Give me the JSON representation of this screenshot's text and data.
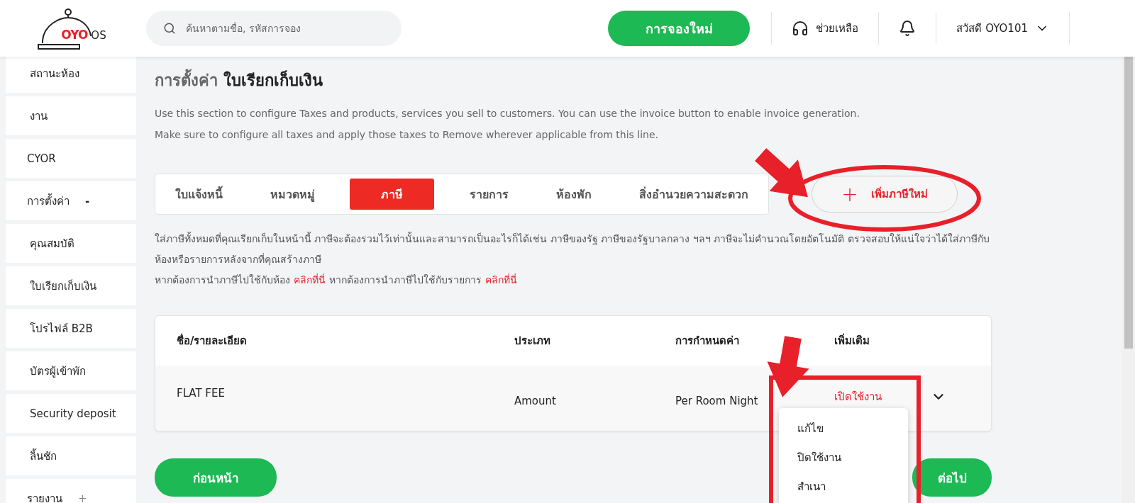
{
  "header": {
    "logo": {
      "brand": "OYO",
      "product": "OS"
    },
    "search": {
      "placeholder": "ค้นหาตามชื่อ, รหัสการจอง"
    },
    "new_booking_button": "การจองใหม่",
    "help": "ช่วยเหลือ",
    "user_menu": "สวัสดี OYO101"
  },
  "sidebar": {
    "items": [
      {
        "label": "สถานะห้อง",
        "kind": "sub"
      },
      {
        "label": "งาน",
        "kind": "sub"
      },
      {
        "label": "CYOR",
        "kind": "section"
      },
      {
        "label": "การตั้งค่า",
        "kind": "section",
        "toggle": "-",
        "expanded": true,
        "children": [
          {
            "label": "คุณสมบัติ",
            "selected": false
          },
          {
            "label": "ใบเรียกเก็บเงิน",
            "selected": false
          },
          {
            "label": "โปรไฟล์ B2B",
            "selected": false
          },
          {
            "label": "บัตรผู้เข้าพัก",
            "selected": false
          },
          {
            "label": "Security deposit",
            "selected": false
          },
          {
            "label": "ลิ้นชัก",
            "selected": false
          }
        ]
      },
      {
        "label": "รายงาน",
        "kind": "section",
        "toggle": "+",
        "expanded": false
      }
    ]
  },
  "page": {
    "title_prefix": "การตั้งค่า",
    "title": "ใบเรียกเก็บเงิน",
    "description": [
      "Use this section to configure Taxes and products, services you sell to customers. You can use the invoice button to enable invoice generation.",
      "Make sure to configure all taxes and apply those taxes to Remove wherever applicable from this line."
    ]
  },
  "tabs": [
    {
      "label": "ใบแจ้งหนี้",
      "selected": false
    },
    {
      "label": "หมวดหมู่",
      "selected": false
    },
    {
      "label": "ภาษี",
      "selected": true
    },
    {
      "label": "รายการ",
      "selected": false
    },
    {
      "label": "ห้องพัก",
      "selected": false
    },
    {
      "label": "สิ่งอำนวยความสะดวก",
      "selected": false
    }
  ],
  "add_button": {
    "icon": "+",
    "label": "เพิ่มภาษีใหม่"
  },
  "note": {
    "text": "ใส่ภาษีทั้งหมดที่คุณเรียกเก็บในหน้านี้ ภาษีจะต้องรวมไว้เท่านั้นและสามารถเป็นอะไรก็ได้เช่น ภาษีของรัฐ ภาษีของรัฐบาลกลาง ฯลฯ ภาษีจะไม่คำนวณโดยอัตโนมัติ ตรวจสอบให้แน่ใจว่าได้ใส่ภาษีกับห้องหรือรายการหลังจากที่คุณสร้างภาษี",
    "links_line": [
      {
        "kind": "text",
        "text": "หากต้องการนำภาษีไปใช้กับห้อง"
      },
      {
        "kind": "link",
        "text": "คลิกที่นี่"
      },
      {
        "kind": "text",
        "text": "หากต้องการนำภาษีไปใช้กับรายการ"
      },
      {
        "kind": "link",
        "text": "คลิกที่นี่"
      }
    ]
  },
  "table": {
    "columns": [
      "ชื่อ/รายละเอียด",
      "ประเภท",
      "การกำหนดค่า",
      "เพิ่มเติม"
    ],
    "rows": [
      {
        "name": "FLAT FEE",
        "type": "Amount",
        "configuration": "Per Room Night",
        "status": "เปิดใช้งาน",
        "menu_open": true,
        "menu": [
          "แก้ไข",
          "ปิดใช้งาน",
          "สำเนา"
        ]
      }
    ]
  },
  "footer": {
    "back_button": "ก่อนหน้า",
    "next_button": "ต่อไป"
  }
}
